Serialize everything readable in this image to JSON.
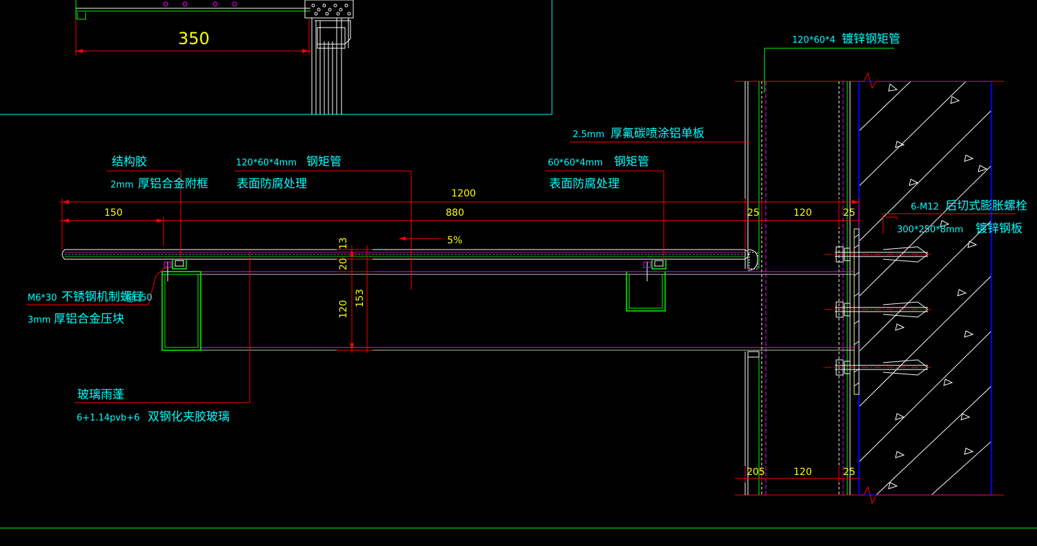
{
  "dims": {
    "top_350": "350",
    "overall_1200": "1200",
    "d_150": "150",
    "d_880": "880",
    "d_25a": "25",
    "d_120a": "120",
    "d_25b": "25",
    "slope": "5%",
    "v_13": "13",
    "v_20": "20",
    "v_120": "120",
    "v_153": "153",
    "b_205": "205",
    "b_120": "120",
    "b_25": "25"
  },
  "labels": {
    "top_tube_spec": "120*60*4",
    "top_tube_name": "镀锌钢矩管",
    "panel_spec": "2.5mm",
    "panel_name": "厚氟碳喷涂铝单板",
    "sealant": "结构胶",
    "frame_spec": "2mm",
    "frame_name": "厚铝合金附框",
    "tube1_spec": "120*60*4mm",
    "tube1_name": "钢矩管",
    "tube1_note": "表面防腐处理",
    "tube2_spec": "60*60*4mm",
    "tube2_name": "钢矩管",
    "tube2_note": "表面防腐处理",
    "bolt_spec": "6-M12",
    "bolt_name": "后切式膨胀螺栓",
    "plate_spec": "300*250*8mm",
    "plate_name": "镀锌钢板",
    "screw_spec": "M6*30",
    "screw_name": "不锈钢机制螺钉",
    "screw_spacing": "@350",
    "block_spec": "3mm",
    "block_name": "厚铝合金压块",
    "canopy": "玻璃雨蓬",
    "glass_spec": "6+1.14pvb+6",
    "glass_name": "双钢化夹胶玻璃"
  },
  "colors": {
    "background": "#000000",
    "dimension": "#ff0000",
    "text": "#00ffff",
    "dim_text": "#ffff00",
    "steel": "#00ff00",
    "beam": "#ff00ff",
    "concrete": "#0000ff",
    "detail": "#ffffff"
  }
}
